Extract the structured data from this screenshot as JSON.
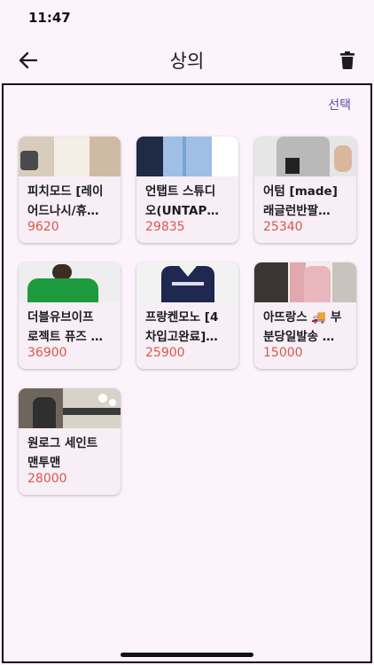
{
  "status_bar": {
    "time": "11:47"
  },
  "app_bar": {
    "title": "상의"
  },
  "toolbar": {
    "select_label": "선택"
  },
  "products": [
    {
      "name": "피치모드 [레이\n어드나시/휴…",
      "price": "9620"
    },
    {
      "name": "언탭트 스튜디\n오(UNTAP…",
      "price": "29835"
    },
    {
      "name": "어텀 [made]\n래글런반팔…",
      "price": "25340"
    },
    {
      "name": "더블유브이프\n로젝트 퓨즈 …",
      "price": "36900"
    },
    {
      "name": "프랑켄모노 [4\n차입고완료]…",
      "price": "25900"
    },
    {
      "name": "아뜨랑스 🚚 부\n분당일발송 …",
      "price": "15000"
    },
    {
      "name": "원로그 세인트\n맨투맨",
      "price": "28000"
    }
  ],
  "colors": {
    "background": "#fcf3fb",
    "card": "#f7eef6",
    "price": "#d65a4a",
    "accent": "#5b4fa3"
  },
  "icons": {
    "back": "arrow-left-icon",
    "delete": "trash-icon"
  }
}
